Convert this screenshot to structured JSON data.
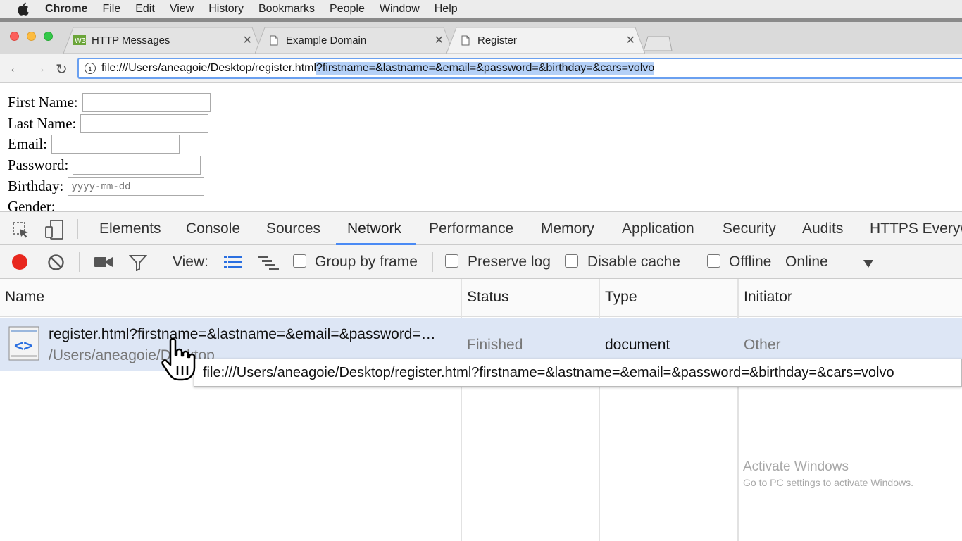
{
  "menubar": {
    "app_name": "Chrome",
    "items": [
      "File",
      "Edit",
      "View",
      "History",
      "Bookmarks",
      "People",
      "Window",
      "Help"
    ]
  },
  "tabs": [
    {
      "title": "HTTP Messages",
      "icon": "w3-favicon-icon"
    },
    {
      "title": "Example Domain",
      "icon": "document-icon"
    },
    {
      "title": "Register",
      "icon": "document-icon",
      "active": true
    }
  ],
  "omnibox": {
    "url_plain": "file:///Users/aneagoie/Desktop/register.html",
    "url_selected": "?firstname=&lastname=&email=&password=&birthday=&cars=volvo"
  },
  "form": {
    "first_name_label": "First Name:",
    "last_name_label": "Last Name:",
    "email_label": "Email:",
    "password_label": "Password:",
    "birthday_label": "Birthday:",
    "birthday_placeholder": "yyyy-mm-dd",
    "gender_label": "Gender:"
  },
  "devtools": {
    "tabs": [
      "Elements",
      "Console",
      "Sources",
      "Network",
      "Performance",
      "Memory",
      "Application",
      "Security",
      "Audits",
      "HTTPS Everyw"
    ],
    "active_tab": "Network",
    "filter": {
      "view_label": "View:",
      "group_by_frame": "Group by frame",
      "preserve_log": "Preserve log",
      "disable_cache": "Disable cache",
      "offline": "Offline",
      "throttle": "Online"
    },
    "columns": [
      "Name",
      "Status",
      "Type",
      "Initiator"
    ],
    "rows": [
      {
        "name": "register.html?firstname=&lastname=&email=&password=…",
        "path": "/Users/aneagoie/Desktop",
        "status": "Finished",
        "type": "document",
        "initiator": "Other"
      }
    ],
    "tooltip": "file:///Users/aneagoie/Desktop/register.html?firstname=&lastname=&email=&password=&birthday=&cars=volvo"
  },
  "watermark": {
    "line1": "Activate Windows",
    "line2": "Go to PC settings to activate Windows."
  },
  "colors": {
    "accent": "#4a8af4",
    "record": "#e8271e",
    "selected_row": "#dde6f5"
  }
}
